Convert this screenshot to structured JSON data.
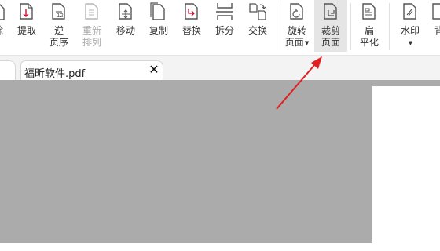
{
  "ribbon": {
    "buttons": [
      {
        "key": "delete",
        "label": "除",
        "icon": "delete-page-icon"
      },
      {
        "key": "extract",
        "label": "提取",
        "icon": "extract-page-icon"
      },
      {
        "key": "reverse",
        "label": "逆",
        "label2": "页序",
        "icon": "reverse-order-icon"
      },
      {
        "key": "rearrange",
        "label": "重新",
        "label2": "排列",
        "icon": "rearrange-icon",
        "disabled": true
      },
      {
        "key": "move",
        "label": "移动",
        "icon": "move-page-icon"
      },
      {
        "key": "copy",
        "label": "复制",
        "icon": "copy-page-icon"
      },
      {
        "key": "replace",
        "label": "替换",
        "icon": "replace-page-icon"
      },
      {
        "key": "split",
        "label": "拆分",
        "icon": "split-page-icon"
      },
      {
        "key": "swap",
        "label": "交换",
        "icon": "swap-page-icon"
      },
      {
        "key": "rotate",
        "label": "旋转",
        "label2": "页面",
        "icon": "rotate-page-icon",
        "dropdown": true
      },
      {
        "key": "crop",
        "label": "裁剪",
        "label2": "页面",
        "icon": "crop-page-icon",
        "active": true
      },
      {
        "key": "flatten",
        "label": "扁",
        "label2": "平化",
        "icon": "flatten-icon"
      },
      {
        "key": "watermark",
        "label": "水印",
        "icon": "watermark-icon",
        "dropdown": true
      },
      {
        "key": "background",
        "label": "背",
        "icon": "background-icon"
      }
    ]
  },
  "tabs": {
    "active_title": "福昕软件.pdf",
    "close_glyph": "✕"
  },
  "colors": {
    "accent": "#c8102e",
    "icon_stroke": "#555555",
    "workspace": "#ababab",
    "arrow": "#e02020"
  }
}
